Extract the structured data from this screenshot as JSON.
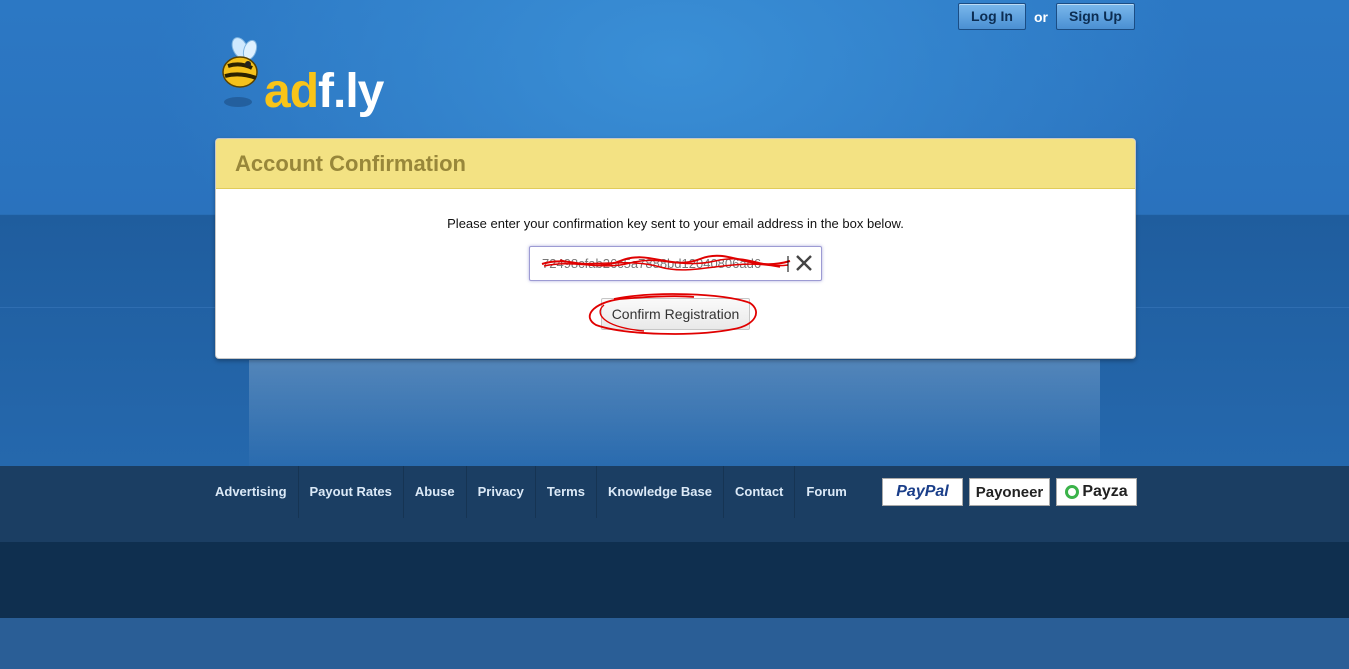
{
  "header": {
    "login_label": "Log In",
    "or_label": "or",
    "signup_label": "Sign Up"
  },
  "logo": {
    "text_ad": "ad",
    "text_fly": "f.ly"
  },
  "card": {
    "title": "Account Confirmation",
    "instruction": "Please enter your confirmation key sent to your email address in the box below.",
    "key_value": "72498cfab26c5a7888bd12040806ad6",
    "confirm_label": "Confirm Registration"
  },
  "footer": {
    "links": [
      "Advertising",
      "Payout Rates",
      "Abuse",
      "Privacy",
      "Terms",
      "Knowledge Base",
      "Contact",
      "Forum"
    ],
    "payments": [
      "PayPal",
      "Payoneer",
      "Payza"
    ]
  },
  "colors": {
    "header_yellow": "#f3e283",
    "title_text": "#98873a",
    "page_blue": "#2c78c4",
    "footer_navy": "#1b3e63",
    "annotation_red": "#e00000"
  }
}
